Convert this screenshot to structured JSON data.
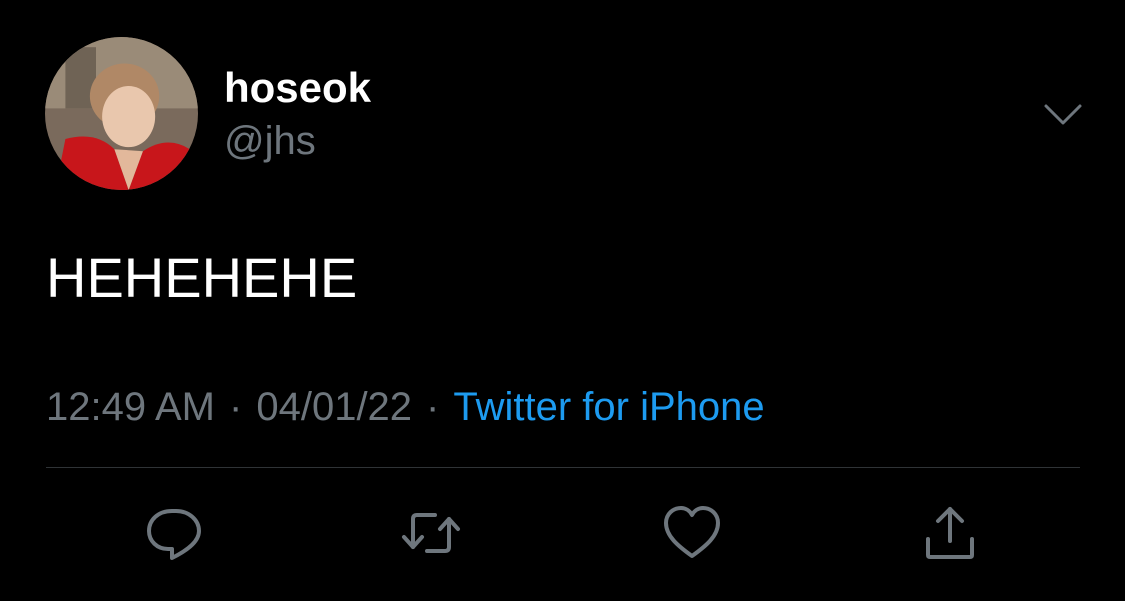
{
  "colors": {
    "background": "#000000",
    "text_primary": "#ffffff",
    "text_secondary": "#6e767d",
    "link": "#1d9bf0",
    "divider": "#2f3336"
  },
  "author": {
    "display_name": "hoseok",
    "handle": "@jhs"
  },
  "tweet": {
    "text": "HEHEHEHE"
  },
  "meta": {
    "time": "12:49 AM",
    "separator": "·",
    "date": "04/01/22",
    "source": "Twitter for iPhone"
  },
  "icons": {
    "more": "chevron-down-icon",
    "reply": "speech-bubble-icon",
    "retweet": "retweet-arrows-icon",
    "like": "heart-icon",
    "share": "share-upload-icon"
  }
}
